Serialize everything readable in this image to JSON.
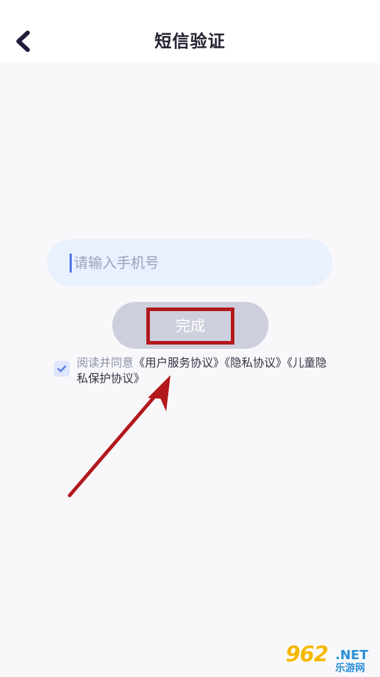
{
  "header": {
    "title": "短信验证",
    "back_icon": "chevron-left-icon"
  },
  "phone": {
    "placeholder": "请输入手机号",
    "value": ""
  },
  "done_button": {
    "label": "完成"
  },
  "agreement": {
    "checked": true,
    "prefix": "阅读并同意",
    "links": [
      "《用户服务协议》",
      "《隐私协议》",
      "《儿童隐私保护协议》"
    ]
  },
  "annotation": {
    "highlight_color": "#b3181b",
    "arrow_color": "#b3181b"
  },
  "watermark": {
    "number": "962",
    "domain": ".NET",
    "site": "乐游网"
  },
  "colors": {
    "accent": "#4a6fe8",
    "input_bg": "#e9f0fe",
    "button_disabled": "#cdcfdd"
  }
}
